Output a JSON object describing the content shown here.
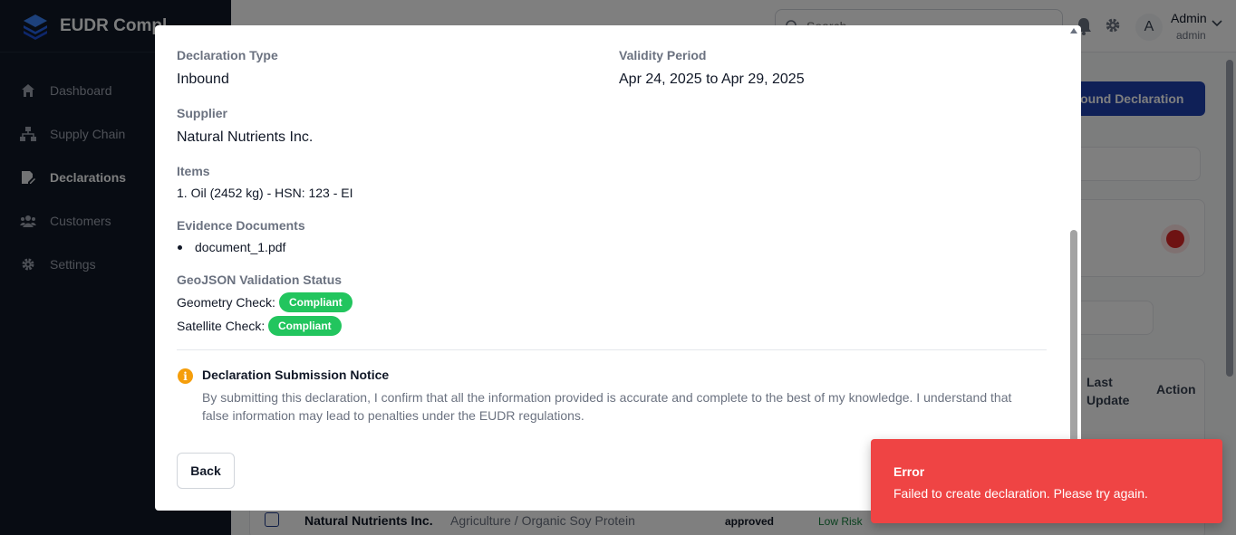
{
  "app": {
    "name": "EUDR Compl",
    "nav": [
      {
        "label": "Dashboard",
        "icon": "home-icon"
      },
      {
        "label": "Supply Chain",
        "icon": "network-icon"
      },
      {
        "label": "Declarations",
        "icon": "document-edit-icon",
        "active": true
      },
      {
        "label": "Customers",
        "icon": "users-icon"
      },
      {
        "label": "Settings",
        "icon": "gear-icon"
      }
    ]
  },
  "topbar": {
    "search_placeholder": "Search...",
    "avatar_initial": "A",
    "user_name": "Admin",
    "user_role": "admin"
  },
  "background": {
    "primary_button": "bound Declaration",
    "table_headers": {
      "last_update": "Last Update",
      "action": "Action"
    },
    "row": {
      "supplier": "Natural Nutrients Inc.",
      "category": "Agriculture / Organic Soy Protein",
      "status": "approved",
      "risk": "Low Risk"
    }
  },
  "modal": {
    "declaration_type_label": "Declaration Type",
    "declaration_type_value": "Inbound",
    "validity_label": "Validity Period",
    "validity_value": "Apr 24, 2025 to Apr 29, 2025",
    "supplier_label": "Supplier",
    "supplier_value": "Natural Nutrients Inc.",
    "items_label": "Items",
    "items": [
      "1. Oil (2452 kg) - HSN: 123 - EI"
    ],
    "evidence_label": "Evidence Documents",
    "documents": [
      "document_1.pdf"
    ],
    "geojson_label": "GeoJSON Validation Status",
    "geometry_check_label": "Geometry Check:",
    "geometry_check_status": "Compliant",
    "satellite_check_label": "Satellite Check:",
    "satellite_check_status": "Compliant",
    "notice_title": "Declaration Submission Notice",
    "notice_text": "By submitting this declaration, I confirm that all the information provided is accurate and complete to the best of my knowledge. I understand that false information may lead to penalties under the EUDR regulations.",
    "back_button": "Back"
  },
  "toast": {
    "title": "Error",
    "message": "Failed to create declaration. Please try again."
  },
  "colors": {
    "sidebar": "#111827",
    "primary": "#1e40af",
    "compliant": "#22c55e",
    "notice_icon": "#f59e0b",
    "error": "#ef4444"
  }
}
